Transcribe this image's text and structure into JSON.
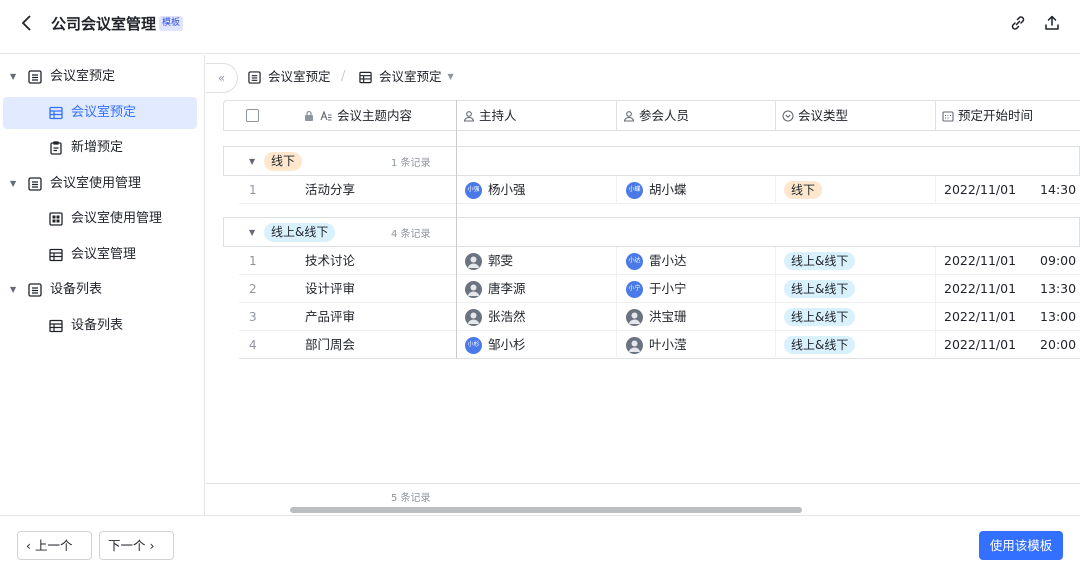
{
  "header": {
    "back_glyph": "‹",
    "title": "公司会议室管理",
    "tag": "模板",
    "icons": [
      "link-icon",
      "share-icon"
    ]
  },
  "sidebar": {
    "items": [
      {
        "label": "会议室预定",
        "level": 0,
        "icon": "table-icon"
      },
      {
        "label": "会议室预定",
        "level": 1,
        "icon": "grid-view-icon",
        "active": true
      },
      {
        "label": "新增预定",
        "level": 1,
        "icon": "form-icon"
      },
      {
        "label": "会议室使用管理",
        "level": 0,
        "icon": "table-icon"
      },
      {
        "label": "会议室使用管理",
        "level": 1,
        "icon": "dashboard-icon"
      },
      {
        "label": "会议室管理",
        "level": 1,
        "icon": "grid-view-icon"
      },
      {
        "label": "设备列表",
        "level": 0,
        "icon": "table-icon"
      },
      {
        "label": "设备列表",
        "level": 1,
        "icon": "grid-view-icon"
      }
    ]
  },
  "toolbar": {
    "collapse_glyph": "«",
    "table_name": "会议室预定",
    "separator": "/",
    "view_name": "会议室预定"
  },
  "columns": [
    "会议主题内容",
    "主持人",
    "参会人员",
    "会议类型",
    "预定开始时间"
  ],
  "groups": [
    {
      "label": "线下",
      "count": "1 条记录",
      "style": "off",
      "rows": [
        {
          "no": "1",
          "topic": "活动分享",
          "host": "杨小强",
          "host_av": "小强",
          "attendee": "胡小蝶",
          "att_av": "小蝶",
          "type": "线下",
          "date": "2022/11/01",
          "time": "14:30"
        }
      ]
    },
    {
      "label": "线上&线下",
      "count": "4 条记录",
      "style": "on",
      "rows": [
        {
          "no": "1",
          "topic": "技术讨论",
          "host": "郭雯",
          "host_av": "",
          "attendee": "雷小达",
          "att_av": "小达",
          "type": "线上&线下",
          "date": "2022/11/01",
          "time": "09:00"
        },
        {
          "no": "2",
          "topic": "设计评审",
          "host": "唐李源",
          "host_av": "",
          "attendee": "于小宁",
          "att_av": "小宁",
          "type": "线上&线下",
          "date": "2022/11/01",
          "time": "13:30"
        },
        {
          "no": "3",
          "topic": "产品评审",
          "host": "张浩然",
          "host_av": "",
          "attendee": "洪宝珊",
          "att_av": "",
          "type": "线上&线下",
          "date": "2022/11/01",
          "time": "13:00"
        },
        {
          "no": "4",
          "topic": "部门周会",
          "host": "邹小杉",
          "host_av": "小杉",
          "attendee": "叶小滢",
          "att_av": "",
          "type": "线上&线下",
          "date": "2022/11/01",
          "time": "20:00"
        }
      ]
    }
  ],
  "footer": {
    "total": "5 条记录"
  },
  "bottom": {
    "prev": "上一个",
    "next": "下一个",
    "use": "使用该模板"
  },
  "colors": {
    "accent": "#3370ff",
    "pill_offline": "#fee7cd",
    "pill_online": "#d9f1fd"
  }
}
